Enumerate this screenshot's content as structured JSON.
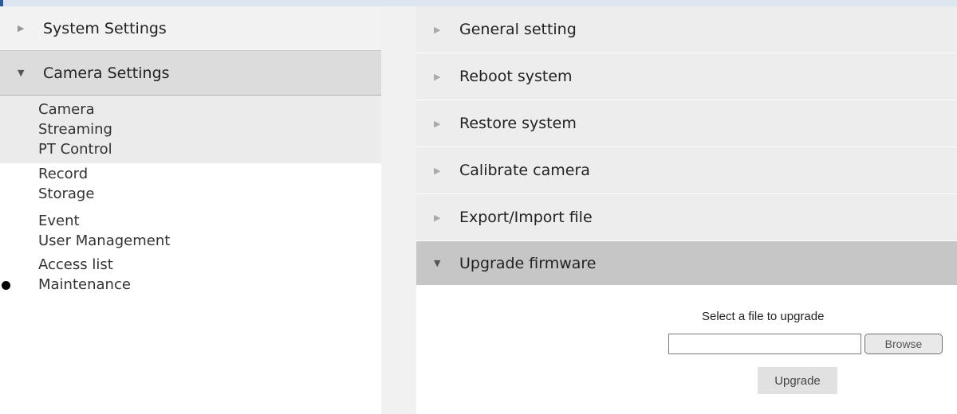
{
  "sidebar": {
    "system_settings": "System Settings",
    "camera_settings": "Camera Settings",
    "camera_sub": [
      "Camera",
      "Streaming",
      "PT Control"
    ],
    "items": [
      "Record",
      "Storage",
      "Event",
      "User Management",
      "Access list",
      "Maintenance"
    ]
  },
  "panel": {
    "sections": [
      "General setting",
      "Reboot system",
      "Restore system",
      "Calibrate camera",
      "Export/Import file"
    ],
    "open_section": "Upgrade firmware",
    "upgrade": {
      "select_label": "Select a file to upgrade",
      "file_value": "",
      "browse_label": "Browse",
      "upgrade_label": "Upgrade"
    }
  },
  "icons": {
    "collapsed": "triangle-right-icon",
    "expanded": "triangle-down-icon",
    "active_marker": "bullet-icon"
  },
  "colors": {
    "selected_header": "#dcdcdc",
    "open_section": "#c6c6c6",
    "sub_background": "#ebebeb"
  }
}
